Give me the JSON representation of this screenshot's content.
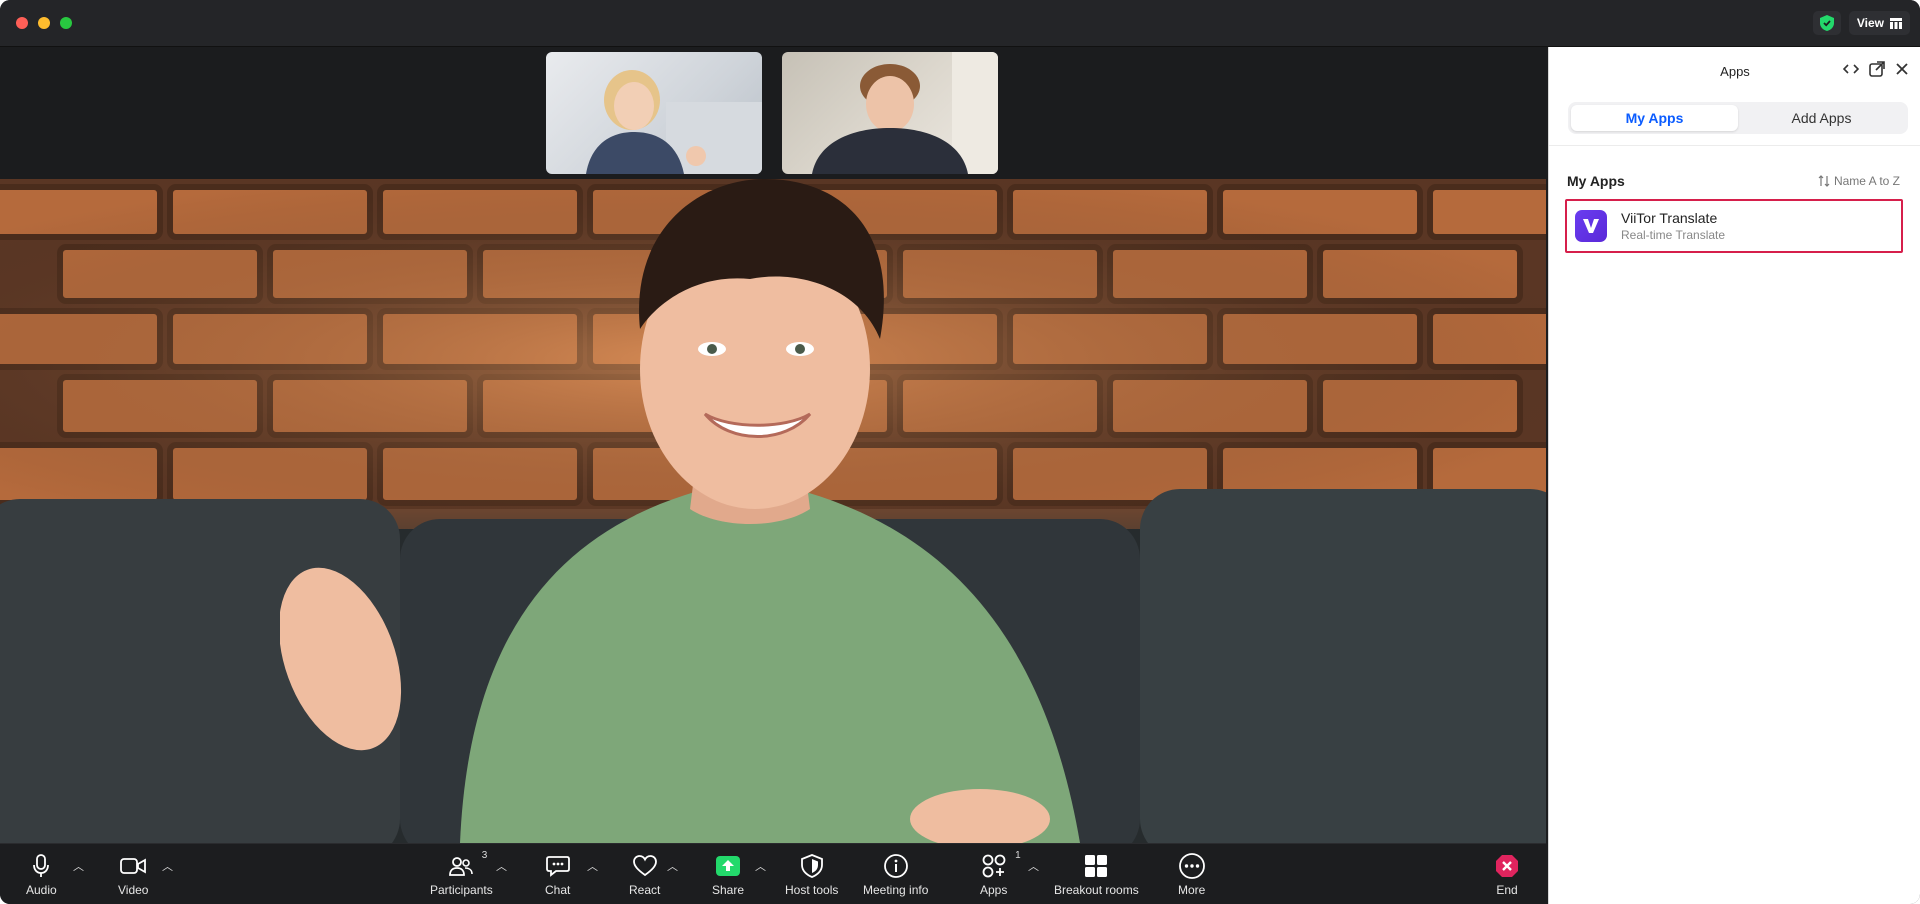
{
  "window": {
    "view_label": "View"
  },
  "toolbar": {
    "audio": "Audio",
    "video": "Video",
    "participants": "Participants",
    "participants_count": "3",
    "chat": "Chat",
    "react": "React",
    "share": "Share",
    "host_tools": "Host tools",
    "meeting_info": "Meeting info",
    "apps": "Apps",
    "apps_count": "1",
    "breakout_rooms": "Breakout rooms",
    "more": "More",
    "end": "End"
  },
  "panel": {
    "title": "Apps",
    "tabs": [
      {
        "label": "My Apps",
        "active": true
      },
      {
        "label": "Add Apps",
        "active": false
      }
    ],
    "section_title": "My Apps",
    "sort_label": "Name A to Z",
    "apps": [
      {
        "name": "ViiTor Translate",
        "subtitle": "Real-time Translate",
        "icon": "viitor-v-logo"
      }
    ]
  },
  "colors": {
    "accent": "#0b5cff",
    "share_green": "#23d96b",
    "end_red": "#e0245e",
    "highlight_border": "#d61f4b",
    "app_purple": "#6a3df0"
  }
}
